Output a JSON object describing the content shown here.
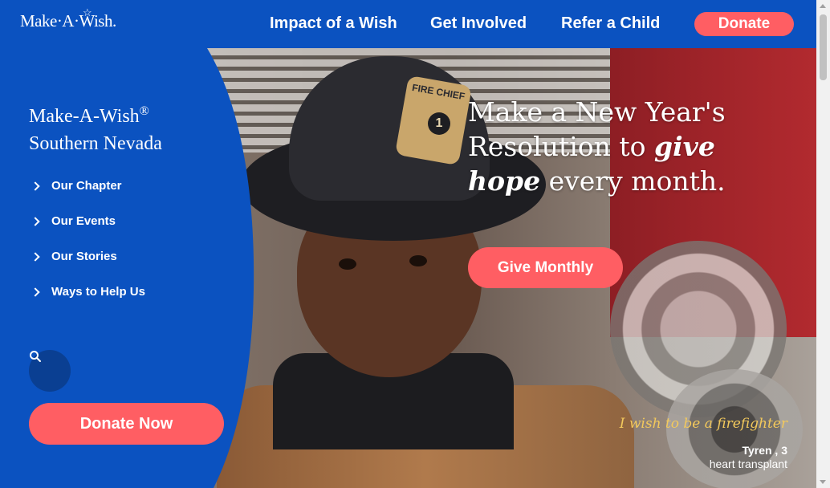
{
  "header": {
    "logo_text": "Make·A·Wish.",
    "nav": [
      {
        "label": "Impact of a Wish"
      },
      {
        "label": "Get Involved"
      },
      {
        "label": "Refer a Child"
      }
    ],
    "donate_label": "Donate"
  },
  "sidebar": {
    "title_line1": "Make-A-Wish",
    "title_mark": "®",
    "title_line2": "Southern Nevada",
    "items": [
      {
        "label": "Our Chapter"
      },
      {
        "label": "Our Events"
      },
      {
        "label": "Our Stories"
      },
      {
        "label": "Ways to Help Us"
      }
    ],
    "donate_now_label": "Donate Now"
  },
  "hero": {
    "headline_part1": "Make a New Year's Resolution to",
    "headline_emphasis": "give hope",
    "headline_part2": "every month.",
    "cta_label": "Give Monthly",
    "helmet_text": "FIRE CHIEF",
    "badge_number": "1",
    "wish_quote": "I wish to be a firefighter",
    "child_name": "Tyren , 3",
    "child_condition": "heart transplant"
  },
  "colors": {
    "brand_blue": "#0b52c0",
    "accent_coral": "#ff5e63",
    "quote_gold": "#f3c95c"
  },
  "icons": {
    "search": "search-icon",
    "chevron": "chevron-right-icon"
  }
}
